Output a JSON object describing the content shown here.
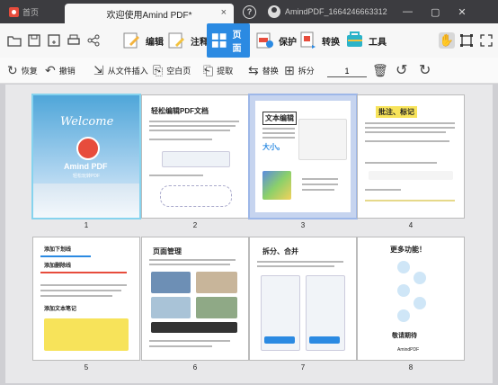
{
  "titlebar": {
    "home_tab": "首页",
    "doc_tab": "欢迎使用Amind PDF*",
    "close_glyph": "×",
    "help_glyph": "?",
    "user": "AmindPDF_1664246663312",
    "minimize": "—",
    "maximize": "▢",
    "close": "✕"
  },
  "ribbon": {
    "tabs": [
      {
        "label": "编辑",
        "icon": "edit-icon"
      },
      {
        "label": "注释",
        "icon": "annotate-icon"
      },
      {
        "label": "页面",
        "icon": "page-icon",
        "active": true
      },
      {
        "label": "保护",
        "icon": "protect-icon"
      },
      {
        "label": "转换",
        "icon": "convert-icon"
      },
      {
        "label": "工具",
        "icon": "tools-icon"
      }
    ]
  },
  "toolbar": {
    "restore": "恢复",
    "undo": "撤销",
    "insert_from_file": "从文件插入",
    "blank_page": "空白页",
    "extract": "提取",
    "replace": "替换",
    "split": "拆分",
    "page_number": "1"
  },
  "pages": [
    {
      "num": "1",
      "title": "Amind PDF",
      "subtitle": "Welcome",
      "sub2": "轻松玩转PDF"
    },
    {
      "num": "2",
      "title": "轻松编辑PDF文档"
    },
    {
      "num": "3",
      "title": "文本编辑",
      "extra": "大小。"
    },
    {
      "num": "4",
      "title": "批注、标记"
    },
    {
      "num": "5",
      "lines": [
        "添加下划线",
        "添加删除线",
        "添加文本笔记"
      ]
    },
    {
      "num": "6",
      "title": "页面管理"
    },
    {
      "num": "7",
      "title": "拆分、合并"
    },
    {
      "num": "8",
      "title": "更多功能！",
      "bottom": "敬请期待",
      "brand": "AmindPDF"
    }
  ]
}
